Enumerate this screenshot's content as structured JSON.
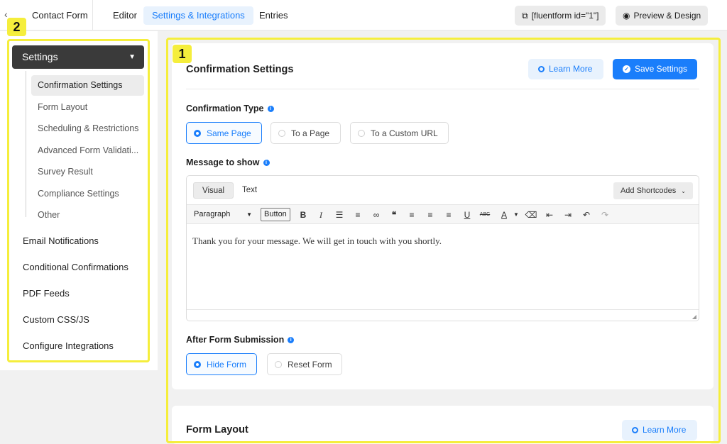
{
  "topbar": {
    "back_icon": "chevron-left-icon",
    "form_name": "Contact Form",
    "tabs": [
      {
        "label": "Editor",
        "active": false
      },
      {
        "label": "Settings & Integrations",
        "active": true
      },
      {
        "label": "Entries",
        "active": false
      }
    ],
    "shortcode_label": "[fluentform id=\"1\"]",
    "preview_label": "Preview & Design"
  },
  "annotations": {
    "main_badge": "1",
    "sidebar_badge": "2",
    "highlight_color": "#f5ee3c"
  },
  "sidebar": {
    "header": "Settings",
    "sub_items": [
      {
        "label": "Confirmation Settings",
        "active": true
      },
      {
        "label": "Form Layout",
        "active": false
      },
      {
        "label": "Scheduling & Restrictions",
        "active": false
      },
      {
        "label": "Advanced Form Validati...",
        "active": false
      },
      {
        "label": "Survey Result",
        "active": false
      },
      {
        "label": "Compliance Settings",
        "active": false
      },
      {
        "label": "Other",
        "active": false
      }
    ],
    "items": [
      {
        "label": "Email Notifications"
      },
      {
        "label": "Conditional Confirmations"
      },
      {
        "label": "PDF Feeds"
      },
      {
        "label": "Custom CSS/JS"
      },
      {
        "label": "Configure Integrations"
      }
    ]
  },
  "confirmation": {
    "title": "Confirmation Settings",
    "learn_more": "Learn More",
    "save": "Save Settings",
    "type_label": "Confirmation Type",
    "type_options": [
      {
        "label": "Same Page",
        "selected": true
      },
      {
        "label": "To a Page",
        "selected": false
      },
      {
        "label": "To a Custom URL",
        "selected": false
      }
    ],
    "message_label": "Message to show",
    "editor": {
      "tab_visual": "Visual",
      "tab_text": "Text",
      "add_shortcodes": "Add Shortcodes",
      "format_select": "Paragraph",
      "button_label": "Button",
      "content": "Thank you for your message. We will get in touch with you shortly."
    },
    "after_label": "After Form Submission",
    "after_options": [
      {
        "label": "Hide Form",
        "selected": true
      },
      {
        "label": "Reset Form",
        "selected": false
      }
    ]
  },
  "form_layout": {
    "title": "Form Layout",
    "learn_more": "Learn More"
  },
  "colors": {
    "accent": "#1a7efb",
    "sidebar_header_bg": "#3a3a3a"
  }
}
